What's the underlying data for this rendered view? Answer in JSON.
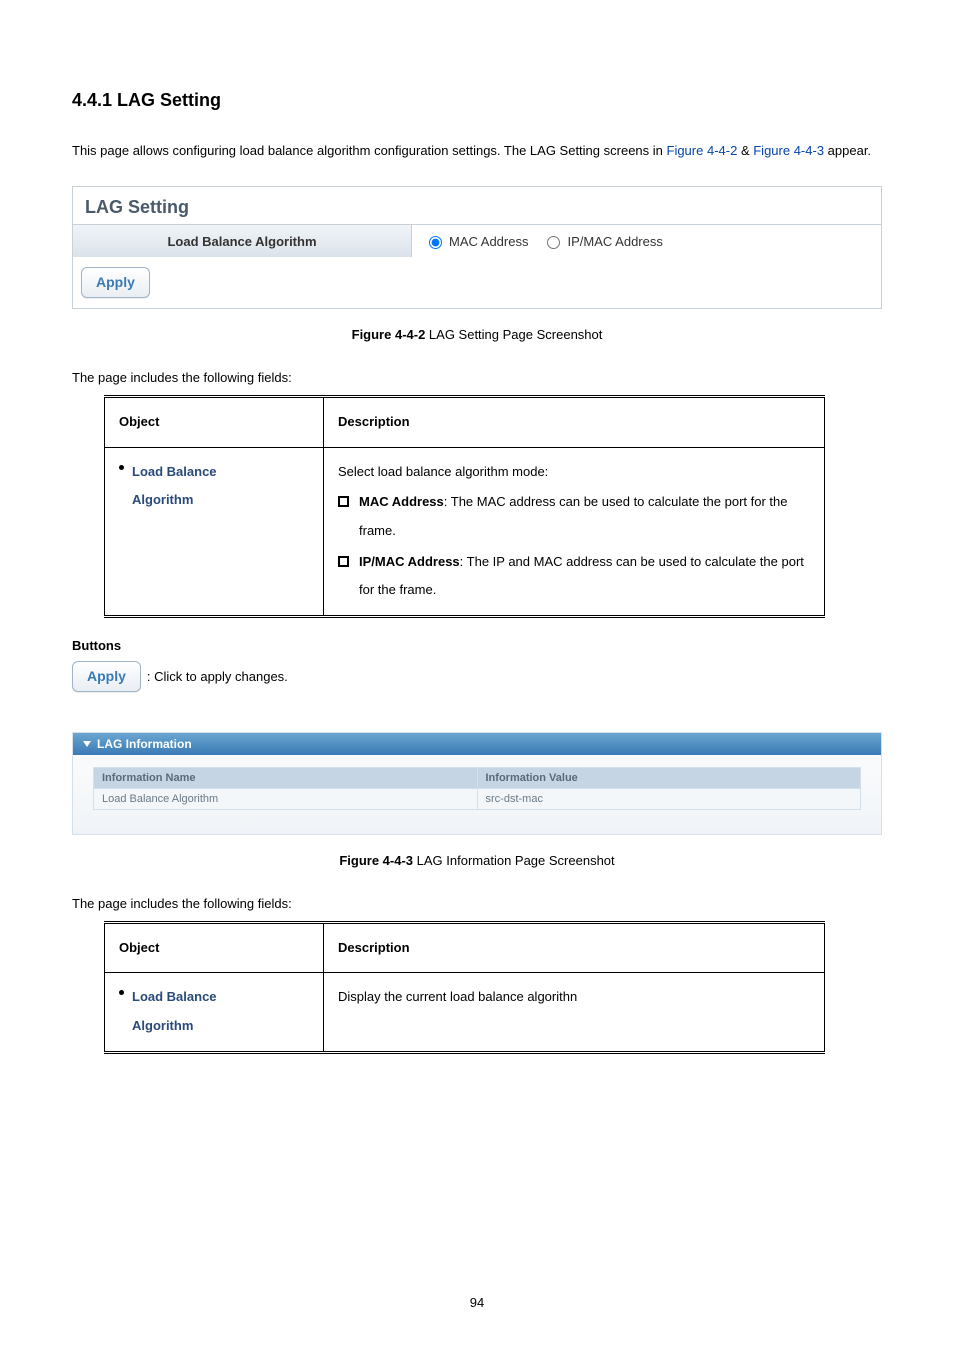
{
  "section": {
    "heading": "4.4.1 LAG Setting"
  },
  "intro": {
    "pre": "This page allows configuring load balance algorithm configuration settings. The LAG Setting screens in ",
    "link1": "Figure 4-4-2",
    "mid": " & ",
    "link2": "Figure 4-4-3",
    "post": " appear."
  },
  "panel1": {
    "title": "LAG Setting",
    "row_label": "Load Balance Algorithm",
    "option1": "MAC Address",
    "option2": "IP/MAC Address",
    "apply": "Apply"
  },
  "figcap1": {
    "bold": "Figure 4-4-2",
    "rest": " LAG Setting Page Screenshot"
  },
  "lead1": "The page includes the following fields:",
  "desc_table1": {
    "h1": "Object",
    "h2": "Description",
    "obj1_line1": "Load Balance",
    "obj1_line2": "Algorithm",
    "desc_intro": "Select load balance algorithm mode:",
    "item1_bold": "MAC Address",
    "item1_rest": ": The MAC address can be used to calculate the port for the frame.",
    "item2_bold": "IP/MAC Address",
    "item2_rest": ": The IP and MAC address can be used to calculate the port for the frame."
  },
  "buttons": {
    "heading": "Buttons",
    "apply": "Apply",
    "note": ": Click to apply changes."
  },
  "panel2": {
    "title": "LAG Information",
    "col1": "Information Name",
    "col2": "Information Value",
    "row_name": "Load Balance Algorithm",
    "row_value": "src-dst-mac"
  },
  "figcap2": {
    "bold": "Figure 4-4-3",
    "rest": " LAG Information Page Screenshot"
  },
  "lead2": "The page includes the following fields:",
  "desc_table2": {
    "h1": "Object",
    "h2": "Description",
    "obj1_line1": "Load Balance",
    "obj1_line2": "Algorithm",
    "desc": "Display the current load balance algorithn"
  },
  "page_number": "94"
}
